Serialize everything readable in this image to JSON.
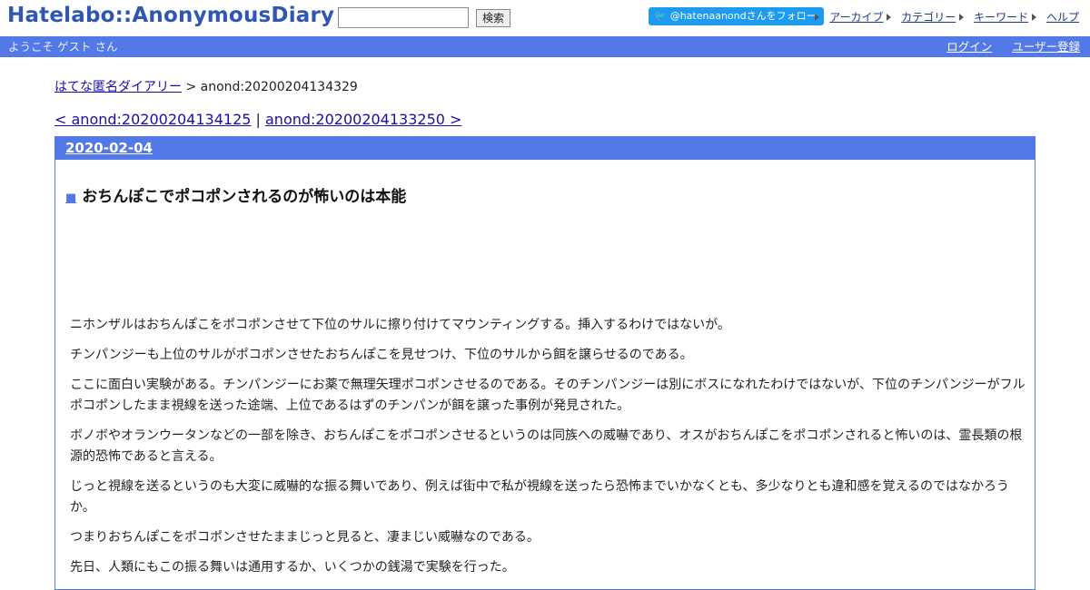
{
  "header": {
    "logo": "Hatelabo::AnonymousDiary",
    "search_placeholder": "",
    "search_button": "検索",
    "follow_button": "@hatenaanondさんをフォロー",
    "links": [
      "アーカイブ",
      "カテゴリー",
      "キーワード",
      "ヘルプ"
    ]
  },
  "bluebar": {
    "welcome": "ようこそ ゲスト さん",
    "login": "ログイン",
    "register": "ユーザー登録"
  },
  "breadcrumb": {
    "home": "はてな匿名ダイアリー",
    "separator": " > ",
    "current": "anond:20200204134329"
  },
  "pager": {
    "prev": "< anond:20200204134125",
    "divider": " | ",
    "next": "anond:20200204133250 >"
  },
  "day": {
    "date": "2020-02-04"
  },
  "entry": {
    "square": "■",
    "title": "おちんぽこでポコポンされるのが怖いのは本能",
    "paragraphs": [
      "ニホンザルはおちんぽこをポコポンさせて下位のサルに擦り付けてマウンティングする。挿入するわけではないが。",
      "チンパンジーも上位のサルがポコポンさせたおちんぽこを見せつけ、下位のサルから餌を譲らせるのである。",
      "ここに面白い実験がある。チンパンジーにお薬で無理矢理ポコポンさせるのである。そのチンパンジーは別にボスになれたわけではないが、下位のチンパンジーがフルポコポンしたまま視線を送った途端、上位であるはずのチンパンが餌を譲った事例が発見された。",
      "ボノボやオランウータンなどの一部を除き、おちんぽこをポコポンさせるというのは同族への威嚇であり、オスがおちんぽこをポコポンされると怖いのは、霊長類の根源的恐怖であると言える。",
      "じっと視線を送るというのも大変に威嚇的な振る舞いであり、例えば街中で私が視線を送ったら恐怖までいかなくとも、多少なりとも違和感を覚えるのではなかろうか。",
      "つまりおちんぽこをポコポンさせたままじっと見ると、凄まじい威嚇なのである。",
      "先日、人類にもこの振る舞いは通用するか、いくつかの銭湯で実験を行った。"
    ]
  }
}
